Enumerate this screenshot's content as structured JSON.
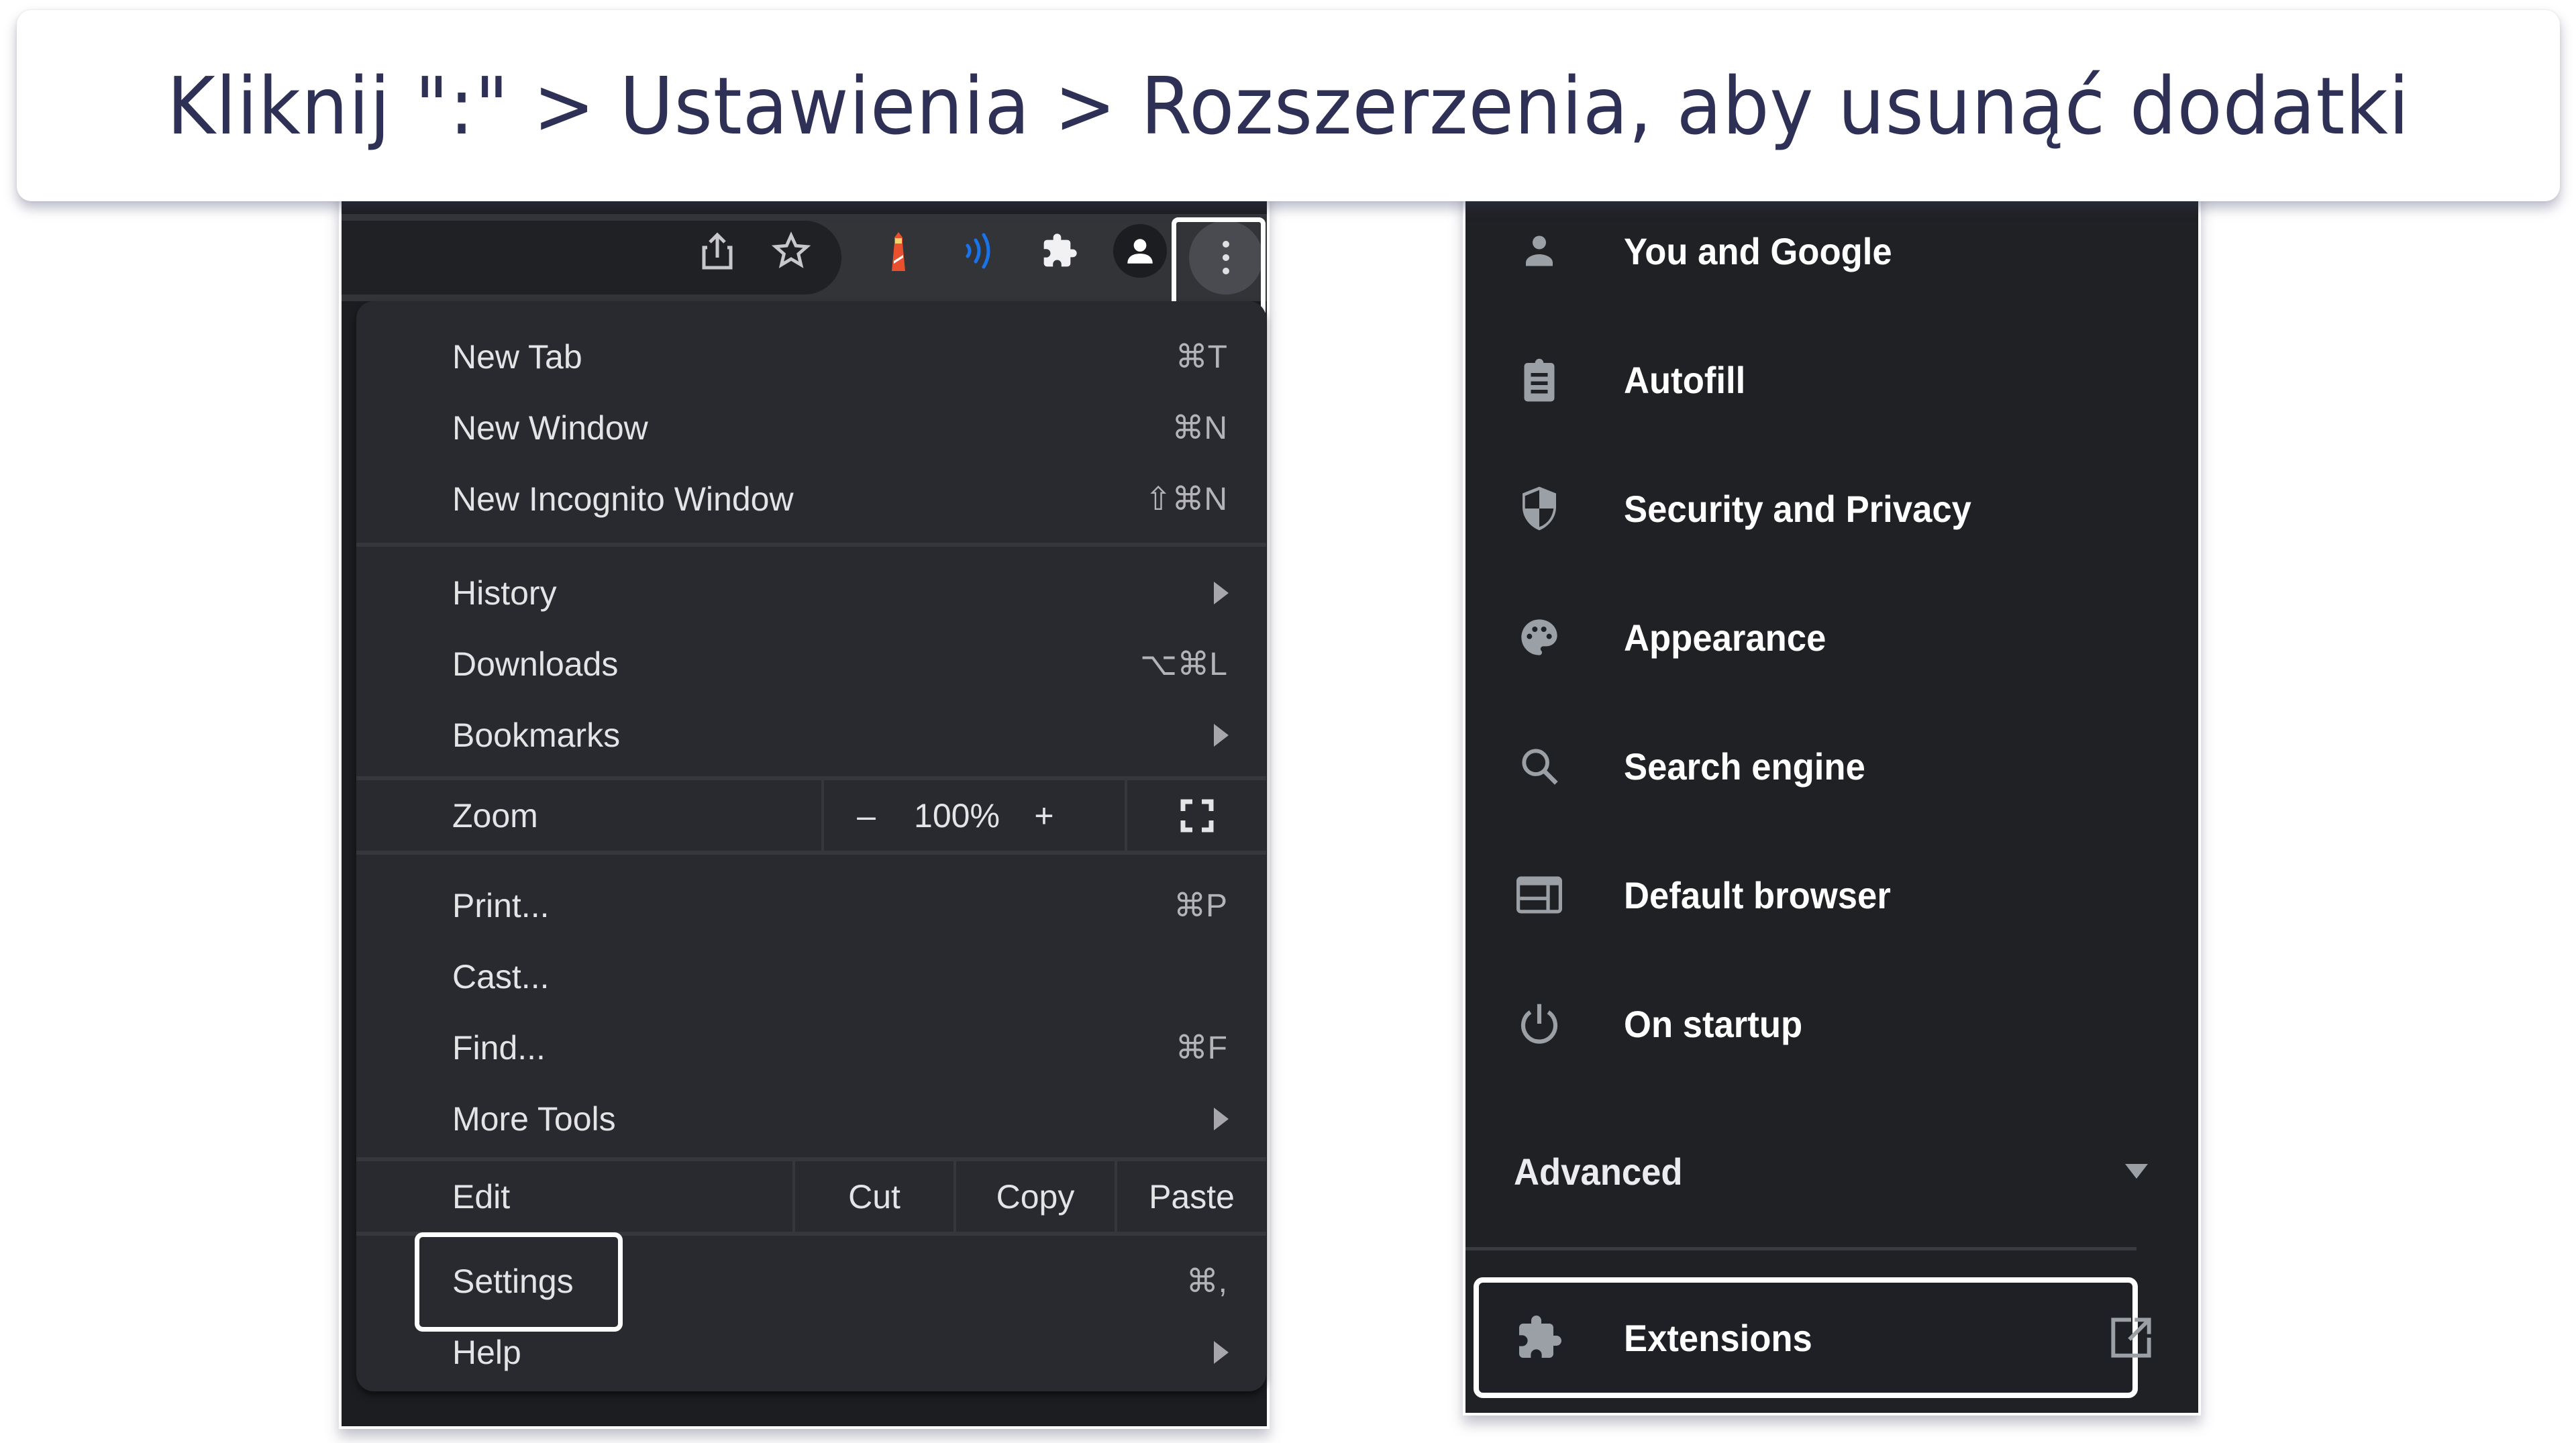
{
  "instruction": {
    "title": "Kliknij \":\" > Ustawienia > Rozszerzenia, aby usunąć dodatki"
  },
  "toolbar": {
    "icons": [
      {
        "name": "share-icon"
      },
      {
        "name": "bookmark-star-icon"
      },
      {
        "name": "lighthouse-extension-icon",
        "color": "#e8502e"
      },
      {
        "name": "wireless-extension-icon",
        "color": "#1a73e8"
      },
      {
        "name": "extensions-puzzle-icon"
      },
      {
        "name": "profile-avatar-icon"
      },
      {
        "name": "kebab-menu-icon"
      }
    ]
  },
  "chrome_menu": {
    "items": [
      {
        "label": "New Tab",
        "shortcut": "⌘T"
      },
      {
        "label": "New Window",
        "shortcut": "⌘N"
      },
      {
        "label": "New Incognito Window",
        "shortcut": "⇧⌘N"
      },
      {
        "label": "History",
        "submenu": true
      },
      {
        "label": "Downloads",
        "shortcut": "⌥⌘L"
      },
      {
        "label": "Bookmarks",
        "submenu": true
      },
      {
        "label": "Print...",
        "shortcut": "⌘P"
      },
      {
        "label": "Cast..."
      },
      {
        "label": "Find...",
        "shortcut": "⌘F"
      },
      {
        "label": "More Tools",
        "submenu": true
      },
      {
        "label": "Settings",
        "shortcut": "⌘,",
        "highlighted": true
      },
      {
        "label": "Help",
        "submenu": true
      }
    ],
    "zoom": {
      "label": "Zoom",
      "minus": "–",
      "value": "100%",
      "plus": "+"
    },
    "edit": {
      "label": "Edit",
      "cut": "Cut",
      "copy": "Copy",
      "paste": "Paste"
    }
  },
  "settings_sidebar": {
    "items": [
      {
        "label": "You and Google",
        "icon": "person-icon"
      },
      {
        "label": "Autofill",
        "icon": "clipboard-icon"
      },
      {
        "label": "Security and Privacy",
        "icon": "shield-icon"
      },
      {
        "label": "Appearance",
        "icon": "palette-icon"
      },
      {
        "label": "Search engine",
        "icon": "search-icon"
      },
      {
        "label": "Default browser",
        "icon": "browser-window-icon"
      },
      {
        "label": "On startup",
        "icon": "power-icon"
      }
    ],
    "advanced": {
      "label": "Advanced"
    },
    "extensions": {
      "label": "Extensions",
      "highlighted": true
    }
  },
  "colors": {
    "title_text": "#2e3056",
    "menu_bg": "#292a2f",
    "settings_bg": "#202124",
    "highlight_outline": "#ffffff"
  }
}
